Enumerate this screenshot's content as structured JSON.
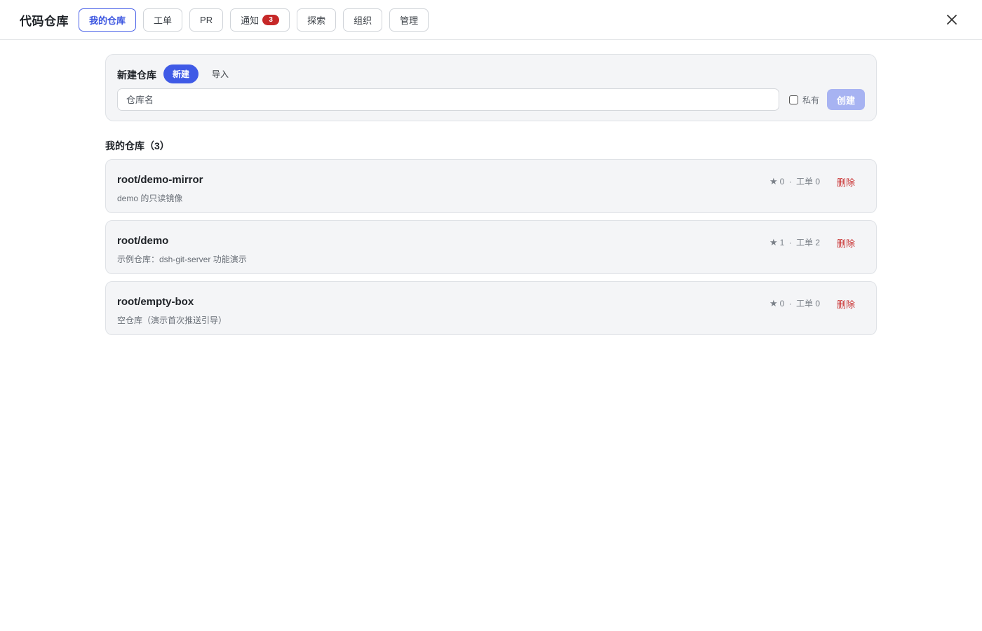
{
  "header": {
    "title": "代码仓库",
    "tabs": [
      {
        "label": "我的仓库",
        "active": true
      },
      {
        "label": "工单"
      },
      {
        "label": "PR"
      },
      {
        "label": "通知",
        "badge": "3"
      },
      {
        "label": "探索"
      },
      {
        "label": "组织"
      },
      {
        "label": "管理"
      }
    ],
    "close_icon": "close-icon"
  },
  "create": {
    "title": "新建仓库",
    "mode_new": "新建",
    "mode_import": "导入",
    "name_placeholder": "仓库名",
    "name_value": "",
    "private_label": "私有",
    "private_checked": false,
    "create_label": "创建"
  },
  "repos_section": {
    "title": "我的仓库（3）"
  },
  "repos": [
    {
      "name": "root/demo-mirror",
      "desc": "demo 的只读镜像",
      "stars": "0",
      "issues_label": "工单 0",
      "delete_label": "删除"
    },
    {
      "name": "root/demo",
      "desc": "示例仓库：dsh-git-server 功能演示",
      "stars": "1",
      "issues_label": "工单 2",
      "delete_label": "删除"
    },
    {
      "name": "root/empty-box",
      "desc": "空仓库（演示首次推送引导）",
      "stars": "0",
      "issues_label": "工单 0",
      "delete_label": "删除"
    }
  ],
  "colors": {
    "accent": "#3f5ae6",
    "danger": "#c62828",
    "card_bg": "#f4f5f7"
  }
}
